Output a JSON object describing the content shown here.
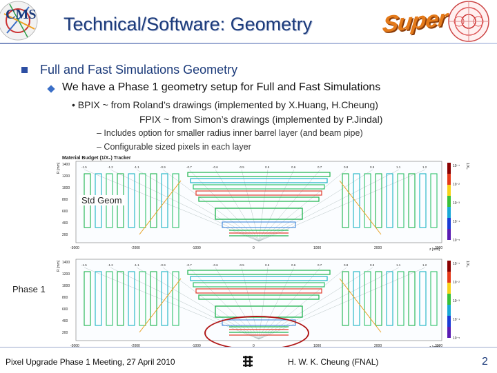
{
  "slide": {
    "title": "Technical/Software: Geometry",
    "logo_text": "CMS",
    "super_logo": "Super",
    "bullet1": "Full and Fast Simulations Geometry",
    "bullet2": "We have a Phase 1 geometry setup for Full and Fast Simulations",
    "bullet3a": "• BPIX ~ from Roland’s drawings (implemented by X.Huang, H.Cheung)",
    "bullet3b": "FPIX ~ from Simon’s drawings (implemented by P.Jindal)",
    "bullet4": "– Includes option for smaller radius inner barrel layer (and beam pipe)",
    "bullet5": "– Configurable sized pixels in each layer",
    "std_label": "Std Geom",
    "phase_label": "Phase 1",
    "footer_left": "Pixel Upgrade Phase 1 Meeting, 27 April 2010",
    "footer_right": "H. W. K. Cheung (FNAL)",
    "page_number": "2"
  },
  "plots": {
    "title": "Material Budget (1/X₀) Tracker",
    "y_unit": "R [mm]",
    "x_unit": "z [mm]",
    "y_ticks": [
      "1400",
      "1200",
      "1000",
      "800",
      "600",
      "400",
      "200"
    ],
    "x_ticks": [
      "-3000",
      "-2000",
      "-1000",
      "0",
      "1000",
      "2000",
      "3000"
    ],
    "eta_ticks": [
      "-1.5",
      "-1.2",
      "-1.1",
      "-0.9",
      "-0.7",
      "-0.6",
      "-0.5",
      "0.5",
      "0.6",
      "0.7",
      "0.8",
      "0.9",
      "1.1",
      "1.2"
    ],
    "colorbar_ticks": [
      "10⁻¹",
      "10⁻²",
      "10⁻³",
      "10⁻⁴",
      "10⁻⁵"
    ],
    "colorbar_label": "1/X₀"
  }
}
